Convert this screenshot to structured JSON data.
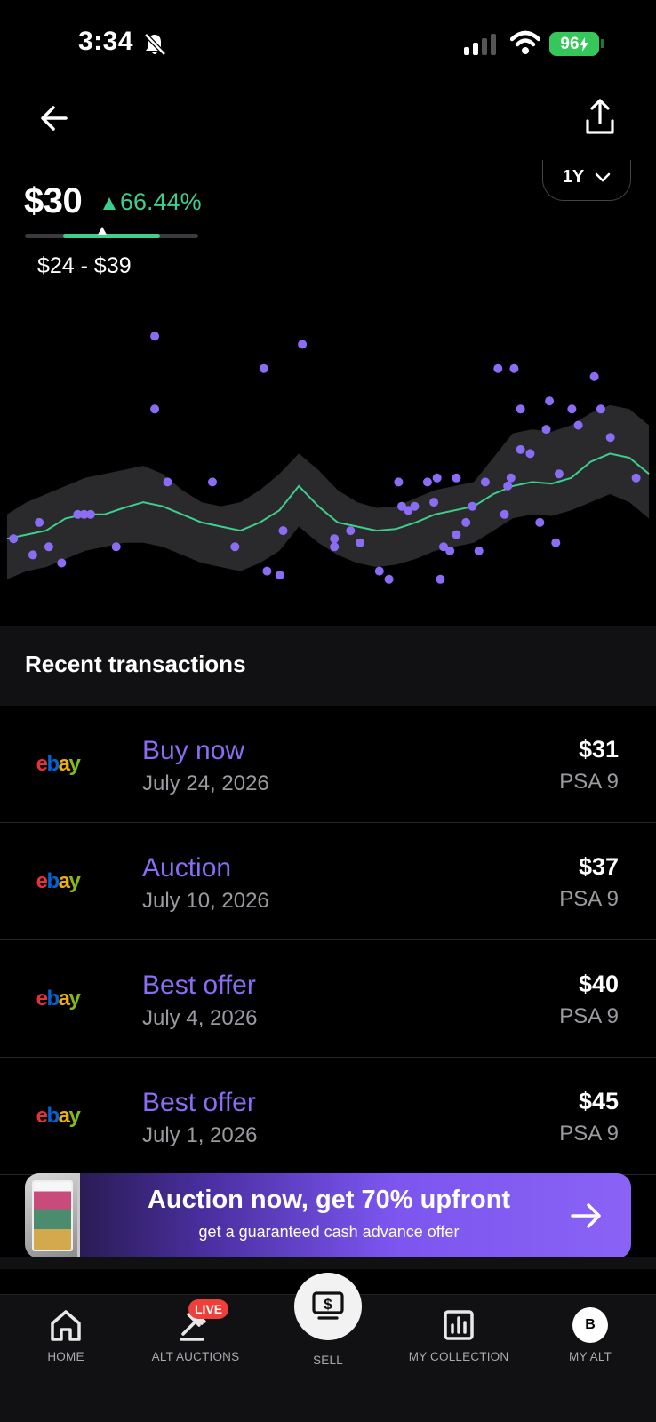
{
  "status": {
    "time": "3:34",
    "battery": "96"
  },
  "header": {
    "period": "1Y"
  },
  "price": {
    "current": "$30",
    "change": "66.44%",
    "range_text": "$24 - $39",
    "range_low": 24,
    "range_high": 39,
    "current_value": 30
  },
  "colors": {
    "accent": "#8b6cf4",
    "positive": "#3ecf8e",
    "band": "#2a2a2c",
    "background": "#000000"
  },
  "chart_data": {
    "type": "scatter",
    "description_free": true,
    "y_unit": "USD",
    "trend_line": [
      31,
      31.5,
      32,
      33.5,
      34,
      34,
      34.8,
      35.5,
      35,
      34,
      33,
      32.5,
      32,
      33,
      34.5,
      37.5,
      35,
      33,
      32.5,
      32,
      32.2,
      33,
      34,
      34.5,
      35,
      36.5,
      37.5,
      38,
      37.8,
      38.5,
      40.5,
      41.5,
      41,
      39
    ],
    "band_upper": [
      34,
      35.5,
      36.5,
      37.5,
      38.5,
      39,
      39.5,
      40,
      39,
      37,
      35.5,
      35,
      35.5,
      37,
      39,
      41.5,
      39.5,
      37,
      35.5,
      34.8,
      35,
      36,
      37,
      37.5,
      38,
      41,
      44,
      44.5,
      44.2,
      45,
      46.5,
      47.5,
      47,
      45
    ],
    "band_lower": [
      26,
      27,
      27.5,
      28.5,
      29.5,
      30,
      30.5,
      30.5,
      30,
      29,
      28,
      27.5,
      27,
      28,
      29.5,
      32.5,
      30.5,
      29,
      28,
      27.5,
      27.8,
      28.5,
      29.5,
      30,
      30.5,
      32,
      33.5,
      34,
      33.8,
      34.5,
      35.5,
      36.5,
      35.5,
      33.5
    ],
    "points": [
      [
        0.01,
        31
      ],
      [
        0.04,
        29
      ],
      [
        0.05,
        33
      ],
      [
        0.065,
        30
      ],
      [
        0.085,
        28
      ],
      [
        0.11,
        34
      ],
      [
        0.12,
        34
      ],
      [
        0.13,
        34
      ],
      [
        0.17,
        30
      ],
      [
        0.23,
        56
      ],
      [
        0.23,
        47
      ],
      [
        0.25,
        38
      ],
      [
        0.32,
        38
      ],
      [
        0.355,
        30
      ],
      [
        0.4,
        52
      ],
      [
        0.405,
        27
      ],
      [
        0.425,
        26.5
      ],
      [
        0.43,
        32
      ],
      [
        0.46,
        55
      ],
      [
        0.51,
        31
      ],
      [
        0.51,
        30
      ],
      [
        0.535,
        32
      ],
      [
        0.55,
        30.5
      ],
      [
        0.58,
        27
      ],
      [
        0.595,
        26
      ],
      [
        0.61,
        38
      ],
      [
        0.615,
        35
      ],
      [
        0.625,
        34.5
      ],
      [
        0.635,
        35
      ],
      [
        0.655,
        38
      ],
      [
        0.665,
        35.5
      ],
      [
        0.67,
        38.5
      ],
      [
        0.675,
        26
      ],
      [
        0.68,
        30
      ],
      [
        0.69,
        29.5
      ],
      [
        0.7,
        31.5
      ],
      [
        0.7,
        38.5
      ],
      [
        0.715,
        33
      ],
      [
        0.725,
        35
      ],
      [
        0.735,
        29.5
      ],
      [
        0.745,
        38
      ],
      [
        0.765,
        52
      ],
      [
        0.775,
        34
      ],
      [
        0.78,
        37.5
      ],
      [
        0.785,
        38.5
      ],
      [
        0.79,
        52
      ],
      [
        0.8,
        47
      ],
      [
        0.8,
        42
      ],
      [
        0.815,
        41.5
      ],
      [
        0.83,
        33
      ],
      [
        0.845,
        48
      ],
      [
        0.84,
        44.5
      ],
      [
        0.855,
        30.5
      ],
      [
        0.86,
        39
      ],
      [
        0.88,
        47
      ],
      [
        0.89,
        45
      ],
      [
        0.915,
        51
      ],
      [
        0.925,
        47
      ],
      [
        0.94,
        43.5
      ],
      [
        0.98,
        38.5
      ]
    ],
    "ylim": [
      24,
      58
    ],
    "grid": false,
    "legend": "none"
  },
  "transactions": {
    "title": "Recent transactions",
    "items": [
      {
        "source": "ebay",
        "type": "Buy now",
        "date": "July 24, 2026",
        "price": "$31",
        "grade": "PSA 9"
      },
      {
        "source": "ebay",
        "type": "Auction",
        "date": "July 10, 2026",
        "price": "$37",
        "grade": "PSA 9"
      },
      {
        "source": "ebay",
        "type": "Best offer",
        "date": "July 4, 2026",
        "price": "$40",
        "grade": "PSA 9"
      },
      {
        "source": "ebay",
        "type": "Best offer",
        "date": "July 1, 2026",
        "price": "$45",
        "grade": "PSA 9"
      }
    ]
  },
  "promo": {
    "title": "Auction now, get 70% upfront",
    "subtitle": "get a guaranteed cash advance offer"
  },
  "tabs": {
    "home": "HOME",
    "alt_auctions": "ALT AUCTIONS",
    "live_badge": "LIVE",
    "sell": "SELL",
    "my_collection": "MY COLLECTION",
    "my_alt": "MY ALT",
    "avatar_initial": "B"
  }
}
